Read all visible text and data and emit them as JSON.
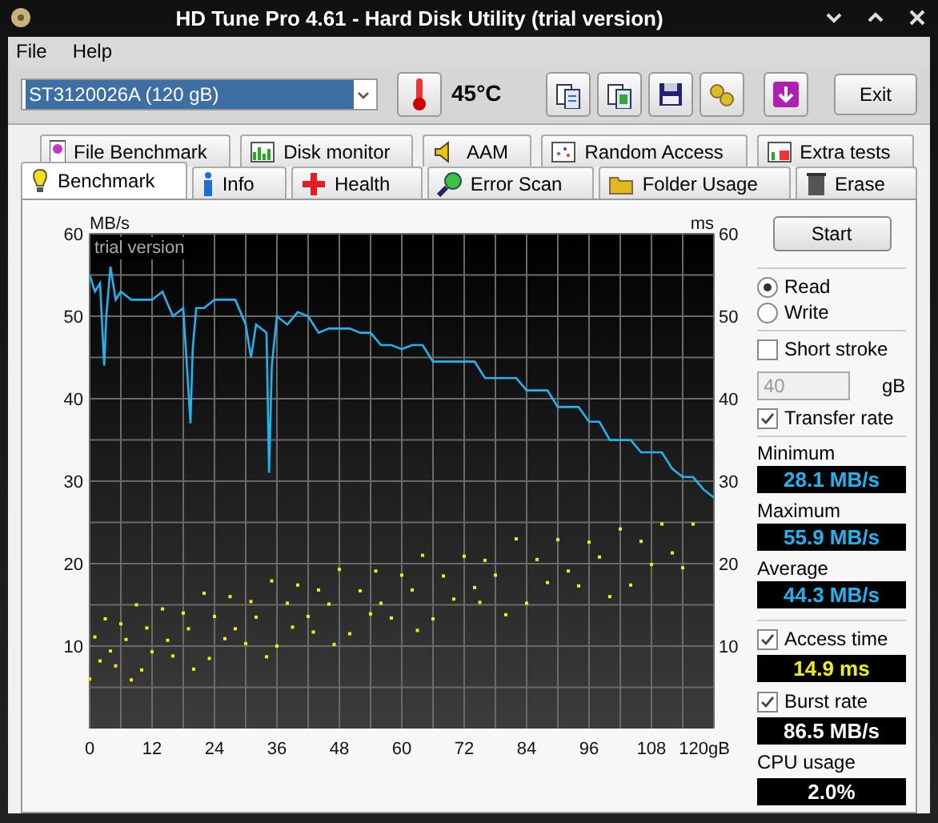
{
  "window": {
    "title": "HD Tune Pro 4.61 - Hard Disk Utility (trial version)"
  },
  "menu": [
    "File",
    "Help"
  ],
  "toolbar": {
    "drive": "ST3120026A (120 gB)",
    "temperature": "45°C",
    "exit": "Exit"
  },
  "tabs": [
    [
      {
        "label": "File Benchmark",
        "selected": false
      },
      {
        "label": "Disk monitor",
        "selected": false
      },
      {
        "label": "AAM",
        "selected": false
      },
      {
        "label": "Random Access",
        "selected": false
      },
      {
        "label": "Extra tests",
        "selected": false
      }
    ],
    [
      {
        "label": "Benchmark",
        "selected": true
      },
      {
        "label": "Info",
        "selected": false
      },
      {
        "label": "Health",
        "selected": false
      },
      {
        "label": "Error Scan",
        "selected": false
      },
      {
        "label": "Folder Usage",
        "selected": false
      },
      {
        "label": "Erase",
        "selected": false
      }
    ]
  ],
  "graph": {
    "watermark": "trial version",
    "chart_data": {
      "type": "line",
      "grid": true,
      "ylabel": "MB/s",
      "xlim": [
        0,
        120
      ],
      "ylim": [
        0,
        60
      ],
      "xticks": [
        0,
        12,
        24,
        36,
        48,
        60,
        72,
        84,
        96,
        108,
        {
          "value": 120,
          "label": "120gB"
        }
      ],
      "yticks": [
        10,
        20,
        30,
        40,
        50,
        60
      ],
      "x": [
        0,
        1,
        2,
        2.8,
        3.2,
        4,
        5,
        6,
        8,
        10,
        12,
        14,
        16,
        18,
        19.4,
        19.8,
        20.5,
        22,
        24,
        26,
        28,
        30,
        31,
        32,
        34,
        34.5,
        35,
        36,
        38,
        40,
        42,
        44,
        46,
        48,
        50,
        52,
        54,
        56,
        58,
        60,
        62,
        64,
        66,
        68,
        70,
        72,
        74,
        76,
        78,
        80,
        82,
        84,
        86,
        88,
        90,
        92,
        94,
        96,
        98,
        100,
        102,
        104,
        106,
        108,
        110,
        112,
        114,
        116,
        118,
        120
      ],
      "series": [
        {
          "color": "#1eb4f0",
          "values": [
            55,
            53,
            54,
            44,
            50,
            56,
            52,
            53,
            52,
            52,
            52,
            53,
            50,
            51,
            37,
            46,
            51,
            51,
            52,
            52,
            52,
            49,
            45,
            49,
            48,
            31,
            44,
            50,
            49,
            50.5,
            50,
            48,
            48.5,
            48.5,
            48.5,
            48,
            48,
            46.5,
            46.5,
            46,
            46.5,
            46.5,
            44.5,
            44.5,
            44.5,
            44.5,
            44.5,
            42.5,
            42.5,
            42.5,
            42.5,
            41,
            41,
            41,
            39,
            39,
            39,
            37.2,
            37.2,
            35,
            35,
            35,
            33.5,
            33.5,
            33.5,
            31.5,
            30.5,
            30.5,
            29,
            28
          ]
        }
      ]
    },
    "access_times": {
      "chart_data": {
        "type": "scatter",
        "ylabel": "ms",
        "xlim": [
          0,
          120
        ],
        "ylim": [
          0,
          60
        ],
        "yticks": [
          10,
          20,
          30,
          40,
          50,
          60
        ],
        "x": [
          0,
          1,
          2,
          3,
          4,
          5,
          6,
          7,
          8,
          9,
          10,
          11,
          12,
          14,
          15,
          16,
          18,
          19,
          20,
          22,
          23,
          24,
          26,
          27,
          28,
          30,
          31,
          32,
          34,
          35,
          36,
          38,
          39,
          40,
          42,
          43,
          44,
          46,
          47,
          48,
          50,
          52,
          54,
          55,
          56,
          58,
          60,
          62,
          63,
          64,
          66,
          68,
          70,
          72,
          74,
          75,
          76,
          78,
          80,
          82,
          84,
          86,
          88,
          90,
          92,
          94,
          96,
          98,
          100,
          102,
          104,
          106,
          108,
          110,
          112,
          114,
          116
        ],
        "series": [
          {
            "color": "#f0f000",
            "values": [
              6,
              11.1,
              8.2,
              13.3,
              9.4,
              7.6,
              12.7,
              10.8,
              5.9,
              15,
              7.1,
              12.2,
              9.3,
              14.5,
              10.7,
              8.8,
              14,
              12.1,
              7.2,
              16.4,
              8.5,
              13.6,
              10.9,
              16,
              12.1,
              10.3,
              15.4,
              13.5,
              8.7,
              17.9,
              10,
              15.2,
              12.3,
              17.4,
              13.6,
              11.7,
              16.8,
              15.1,
              10.2,
              19.3,
              11.5,
              16.7,
              13.9,
              19.1,
              15.2,
              13.4,
              18.6,
              16.8,
              11.9,
              21,
              13.3,
              18.5,
              15.7,
              20.9,
              17.1,
              15.3,
              20.4,
              18.6,
              13.8,
              23,
              15.2,
              20.5,
              17.7,
              22.9,
              19.1,
              17.3,
              22.6,
              20.8,
              16,
              24.2,
              17.4,
              22.7,
              19.9,
              24.8,
              21.3,
              19.5,
              24.8
            ]
          }
        ]
      }
    }
  },
  "side": {
    "start": "Start",
    "modes": [
      {
        "label": "Read",
        "selected": true
      },
      {
        "label": "Write",
        "selected": false
      }
    ],
    "short_stroke": {
      "label": "Short stroke",
      "checked": false,
      "value": "40",
      "unit": "gB",
      "disabled": true
    },
    "transfer_rate": {
      "label": "Transfer rate",
      "checked": true
    },
    "rates": [
      {
        "label": "Minimum",
        "reading": "28.1 MB/s",
        "kind": "transfer"
      },
      {
        "label": "Maximum",
        "reading": "55.9 MB/s",
        "kind": "transfer"
      },
      {
        "label": "Average",
        "reading": "44.3 MB/s",
        "kind": "transfer"
      }
    ],
    "extras": [
      {
        "label": "Access time",
        "checked": true,
        "reading": "14.9 ms",
        "kind": "access"
      },
      {
        "label": "Burst rate",
        "checked": true,
        "reading": "86.5 MB/s",
        "kind": "burst"
      }
    ],
    "cpu": {
      "label": "CPU usage",
      "reading": "2.0%",
      "kind": "cpu"
    }
  }
}
